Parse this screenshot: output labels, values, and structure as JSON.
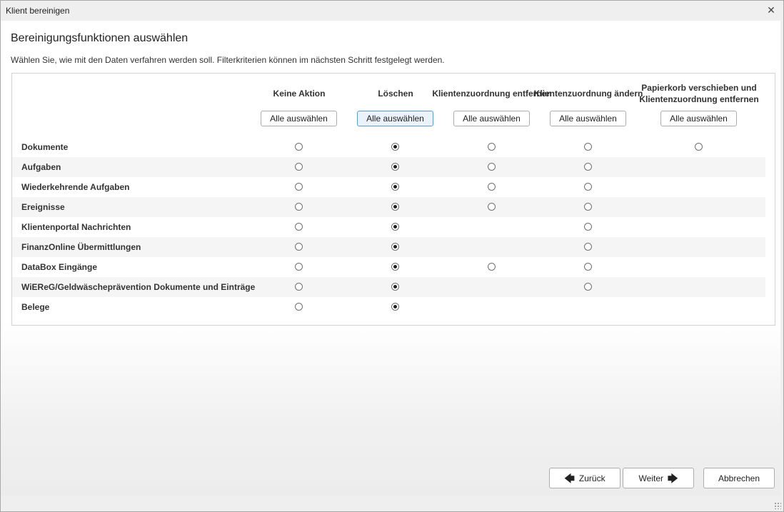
{
  "window": {
    "title": "Klient bereinigen",
    "close_icon": "close-icon"
  },
  "heading": "Bereinigungsfunktionen auswählen",
  "subtext": "Wählen Sie, wie mit den Daten verfahren werden soll. Filterkriterien können im nächsten Schritt festgelegt werden.",
  "columns": [
    {
      "label": "Keine Aktion",
      "button": "Alle auswählen"
    },
    {
      "label": "Löschen",
      "button": "Alle auswählen"
    },
    {
      "label": "Klientenzuordnung entfernen",
      "button": "Alle auswählen"
    },
    {
      "label": "Klientenzuordnung ändern",
      "button": "Alle auswählen"
    },
    {
      "label": "Papierkorb verschieben und Klientenzuordnung entfernen",
      "button": "Alle auswählen"
    }
  ],
  "rows": [
    {
      "label": "Dokumente",
      "options": [
        0,
        1,
        2,
        3,
        4
      ],
      "selected": 1
    },
    {
      "label": "Aufgaben",
      "options": [
        0,
        1,
        2,
        3
      ],
      "selected": 1
    },
    {
      "label": "Wiederkehrende Aufgaben",
      "options": [
        0,
        1,
        2,
        3
      ],
      "selected": 1
    },
    {
      "label": "Ereignisse",
      "options": [
        0,
        1,
        2,
        3
      ],
      "selected": 1
    },
    {
      "label": "Klientenportal Nachrichten",
      "options": [
        0,
        1,
        3
      ],
      "selected": 1
    },
    {
      "label": "FinanzOnline Übermittlungen",
      "options": [
        0,
        1,
        3
      ],
      "selected": 1
    },
    {
      "label": "DataBox Eingänge",
      "options": [
        0,
        1,
        2,
        3
      ],
      "selected": 1
    },
    {
      "label": "WiEReG/Geldwäscheprävention Dokumente und Einträge",
      "options": [
        0,
        1,
        3
      ],
      "selected": 1
    },
    {
      "label": "Belege",
      "options": [
        0,
        1
      ],
      "selected": 1
    }
  ],
  "footer": {
    "back_label": "Zurück",
    "next_label": "Weiter",
    "cancel_label": "Abbrechen"
  },
  "colors": {
    "accent_border": "#5b9bd5",
    "accent_bg": "#eaf3fc",
    "row_alt": "#f5f5f5"
  }
}
